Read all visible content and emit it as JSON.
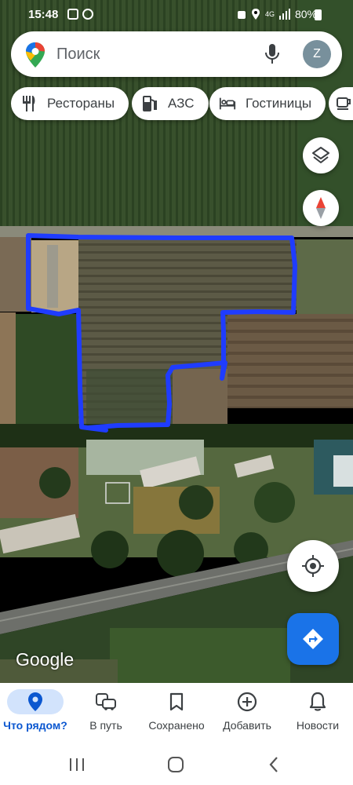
{
  "status_bar": {
    "time": "15:48",
    "network": "4G",
    "battery": "80%"
  },
  "search": {
    "placeholder": "Поиск",
    "avatar_letter": "Z"
  },
  "chips": [
    {
      "label": "Рестораны",
      "icon": "restaurant-icon"
    },
    {
      "label": "АЗС",
      "icon": "gas-station-icon"
    },
    {
      "label": "Гостиницы",
      "icon": "hotel-icon"
    },
    {
      "label": "",
      "icon": "cafe-icon"
    }
  ],
  "map": {
    "type": "satellite",
    "attribution": "Google",
    "overlay_color": "#1f3cff",
    "layers_icon": "layers-icon",
    "compass_icon": "compass-icon",
    "location_icon": "my-location-icon",
    "directions_icon": "directions-icon"
  },
  "bottom_nav": [
    {
      "label": "Что рядом?",
      "icon": "explore-pin-icon",
      "active": true
    },
    {
      "label": "В путь",
      "icon": "commute-icon",
      "active": false
    },
    {
      "label": "Сохранено",
      "icon": "bookmark-icon",
      "active": false
    },
    {
      "label": "Добавить",
      "icon": "add-circle-icon",
      "active": false
    },
    {
      "label": "Новости",
      "icon": "bell-icon",
      "active": false
    }
  ],
  "colors": {
    "accent": "#1a73e8",
    "active_tab_bg": "#d2e3fc",
    "active_tab_text": "#0b57d0"
  }
}
